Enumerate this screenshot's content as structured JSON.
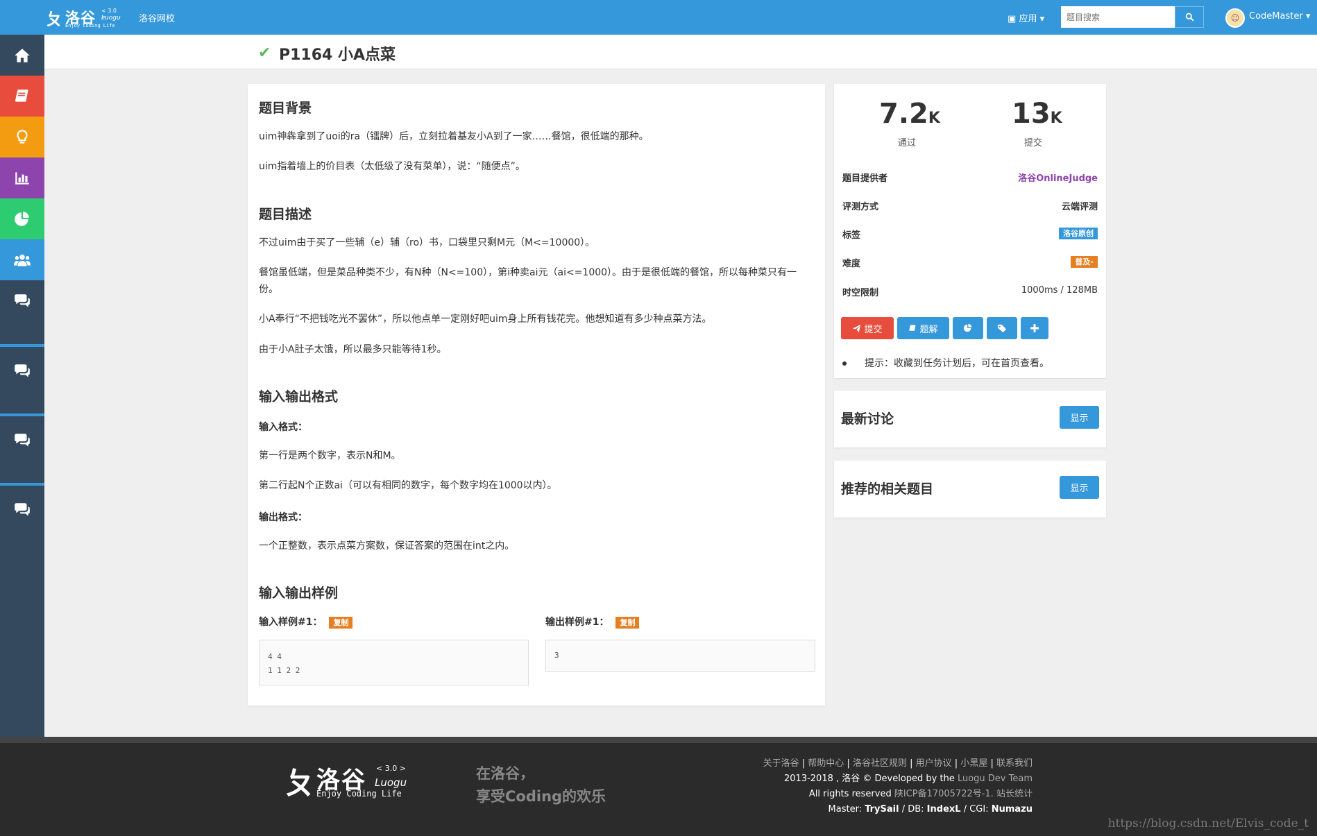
{
  "header": {
    "logo": {
      "glyph": "ㄆ",
      "name": "洛谷",
      "version": "< 3.0 >",
      "luogu": "Luogu",
      "tagline": "Enjoy Coding Life"
    },
    "school_link": "洛谷网校",
    "apps_label": "应用",
    "search": {
      "placeholder": "题目搜索"
    },
    "user": {
      "name": "CodeMaster"
    }
  },
  "sidebar": {
    "items": [
      {
        "icon": "home-icon",
        "color": "#34495e"
      },
      {
        "icon": "book-icon",
        "color": "#e74c3c"
      },
      {
        "icon": "lightbulb-icon",
        "color": "#f39c12"
      },
      {
        "icon": "bar-chart-icon",
        "color": "#8e44ad"
      },
      {
        "icon": "pie-chart-icon",
        "color": "#2ecc71"
      },
      {
        "icon": "users-icon",
        "color": "#3498db"
      },
      {
        "icon": "comments-icon",
        "color": "#34495e"
      },
      {
        "icon": "comments-icon",
        "color": "#34495e"
      },
      {
        "icon": "comments-icon",
        "color": "#34495e"
      },
      {
        "icon": "comments-icon",
        "color": "#34495e"
      }
    ]
  },
  "problem": {
    "title": "P1164 小A点菜",
    "background_heading": "题目背景",
    "background": [
      "uim神犇拿到了uoi的ra（镭牌）后，立刻拉着基友小A到了一家……餐馆，很低端的那种。",
      "uim指着墙上的价目表（太低级了没有菜单），说：“随便点”。"
    ],
    "description_heading": "题目描述",
    "description": [
      "不过uim由于买了一些辅（e）辅（ro）书，口袋里只剩M元（M<=10000）。",
      "餐馆虽低端，但是菜品种类不少，有N种（N<=100），第i种卖ai元（ai<=1000）。由于是很低端的餐馆，所以每种菜只有一份。",
      "小A奉行“不把钱吃光不罢休”，所以他点单一定刚好吧uim身上所有钱花完。他想知道有多少种点菜方法。",
      "由于小A肚子太饿，所以最多只能等待1秒。"
    ],
    "io_heading": "输入输出格式",
    "input_format_label": "输入格式：",
    "input_format": [
      "第一行是两个数字，表示N和M。",
      "第二行起N个正数ai（可以有相同的数字，每个数字均在1000以内）。"
    ],
    "output_format_label": "输出格式：",
    "output_format": [
      "一个正整数，表示点菜方案数，保证答案的范围在int之内。"
    ],
    "samples_heading": "输入输出样例",
    "sample_input_label": "输入样例#1：",
    "sample_output_label": "输出样例#1：",
    "copy_label": "复制",
    "sample_input": "4 4\n1 1 2 2",
    "sample_output": "3"
  },
  "stats": {
    "accepted_num": "7.2",
    "accepted_unit": "K",
    "accepted_label": "通过",
    "submit_num": "13",
    "submit_unit": "K",
    "submit_label": "提交"
  },
  "info": {
    "provider_key": "题目提供者",
    "provider_val": "洛谷OnlineJudge",
    "judge_key": "评测方式",
    "judge_val": "云端评测",
    "tags_key": "标签",
    "tags_val": "洛谷原创",
    "difficulty_key": "难度",
    "difficulty_val": "普及-",
    "limits_key": "时空限制",
    "limits_val": "1000ms / 128MB"
  },
  "actions": {
    "submit_label": "提交",
    "solution_label": "题解"
  },
  "tip": "提示：收藏到任务计划后，可在首页查看。",
  "panels": {
    "discussion_title": "最新讨论",
    "related_title": "推荐的相关题目",
    "show_label": "显示"
  },
  "footer": {
    "slogan_1": "在洛谷，",
    "slogan_2": "享受Coding的欢乐",
    "links": [
      "关于洛谷",
      "帮助中心",
      "洛谷社区规则",
      "用户协议",
      "小黑屋",
      "联系我们"
    ],
    "copyright_prefix": "2013-2018 , 洛谷 © Developed by the ",
    "team": "Luogu Dev Team",
    "rights": "All rights reserved ",
    "icp": "陕ICP备17005722号-1. 站长统计",
    "master_label": "Master: ",
    "master": "TrySail",
    "db_label": " / DB: ",
    "db": "IndexL",
    "cgi_label": " / CGI: ",
    "cgi": "Numazu"
  },
  "watermark": "https://blog.csdn.net/Elvis_code_t"
}
